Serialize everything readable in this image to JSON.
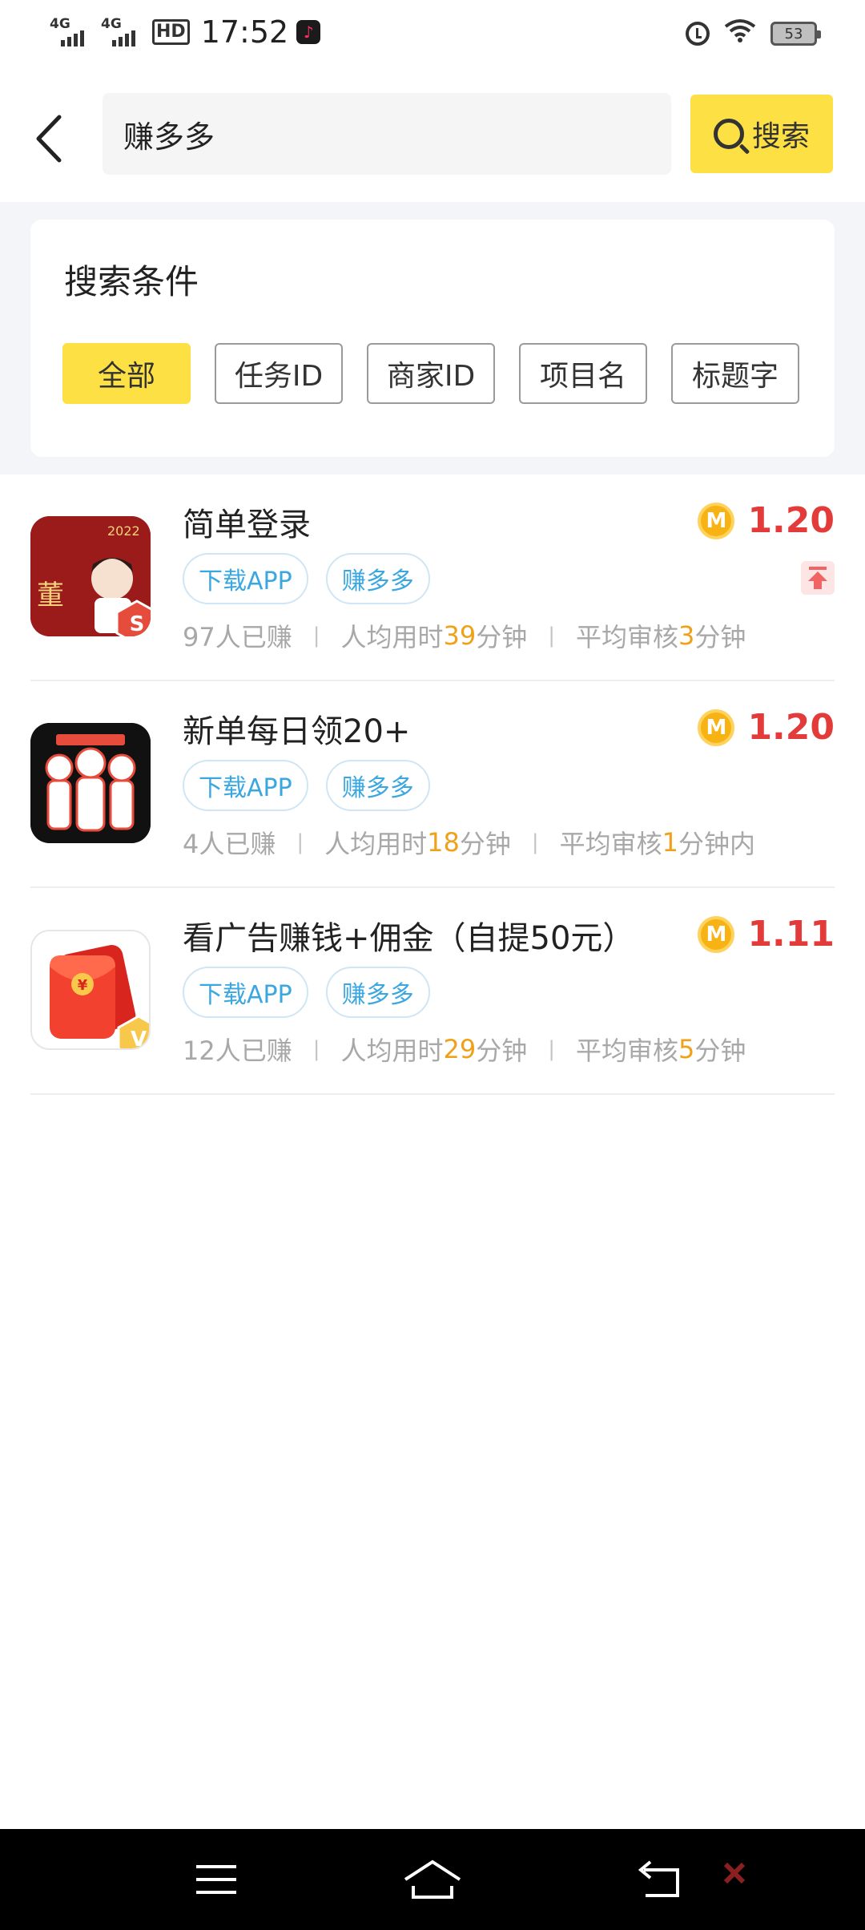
{
  "status_bar": {
    "signal1": "4G",
    "signal2": "4G",
    "hd": "HD",
    "time": "17:52",
    "battery": "53"
  },
  "search": {
    "query": "赚多多",
    "button_label": "搜索"
  },
  "conditions": {
    "title": "搜索条件",
    "chips": [
      "全部",
      "任务ID",
      "商家ID",
      "项目名",
      "标题字"
    ],
    "active_index": 0
  },
  "tasks": [
    {
      "title": "简单登录",
      "price": "1.20",
      "coin_letter": "M",
      "tags": [
        "下载APP",
        "赚多多"
      ],
      "earned": "97人已赚",
      "avg_prefix": "人均用时",
      "avg_value": "39",
      "avg_unit": "分钟",
      "review_prefix": "平均审核",
      "review_value": "3",
      "review_unit": "分钟",
      "thumb_badge": "S",
      "thumb_text": "2022",
      "thumb_name": "董",
      "pinned": true
    },
    {
      "title": "新单每日领20+",
      "price": "1.20",
      "coin_letter": "M",
      "tags": [
        "下载APP",
        "赚多多"
      ],
      "earned": "4人已赚",
      "avg_prefix": "人均用时",
      "avg_value": "18",
      "avg_unit": "分钟",
      "review_prefix": "平均审核",
      "review_value": "1",
      "review_unit": "分钟内",
      "pinned": false
    },
    {
      "title": "看广告赚钱+佣金（自提50元）",
      "price": "1.11",
      "coin_letter": "M",
      "tags": [
        "下载APP",
        "赚多多"
      ],
      "earned": "12人已赚",
      "avg_prefix": "人均用时",
      "avg_value": "29",
      "avg_unit": "分钟",
      "review_prefix": "平均审核",
      "review_value": "5",
      "review_unit": "分钟",
      "thumb_badge": "V",
      "thumb_text": "¥",
      "pinned": false
    }
  ],
  "colors": {
    "accent_yellow": "#fde144",
    "price_red": "#e33a3a",
    "tag_blue": "#3aa7e0",
    "highlight_orange": "#f0a11a"
  }
}
